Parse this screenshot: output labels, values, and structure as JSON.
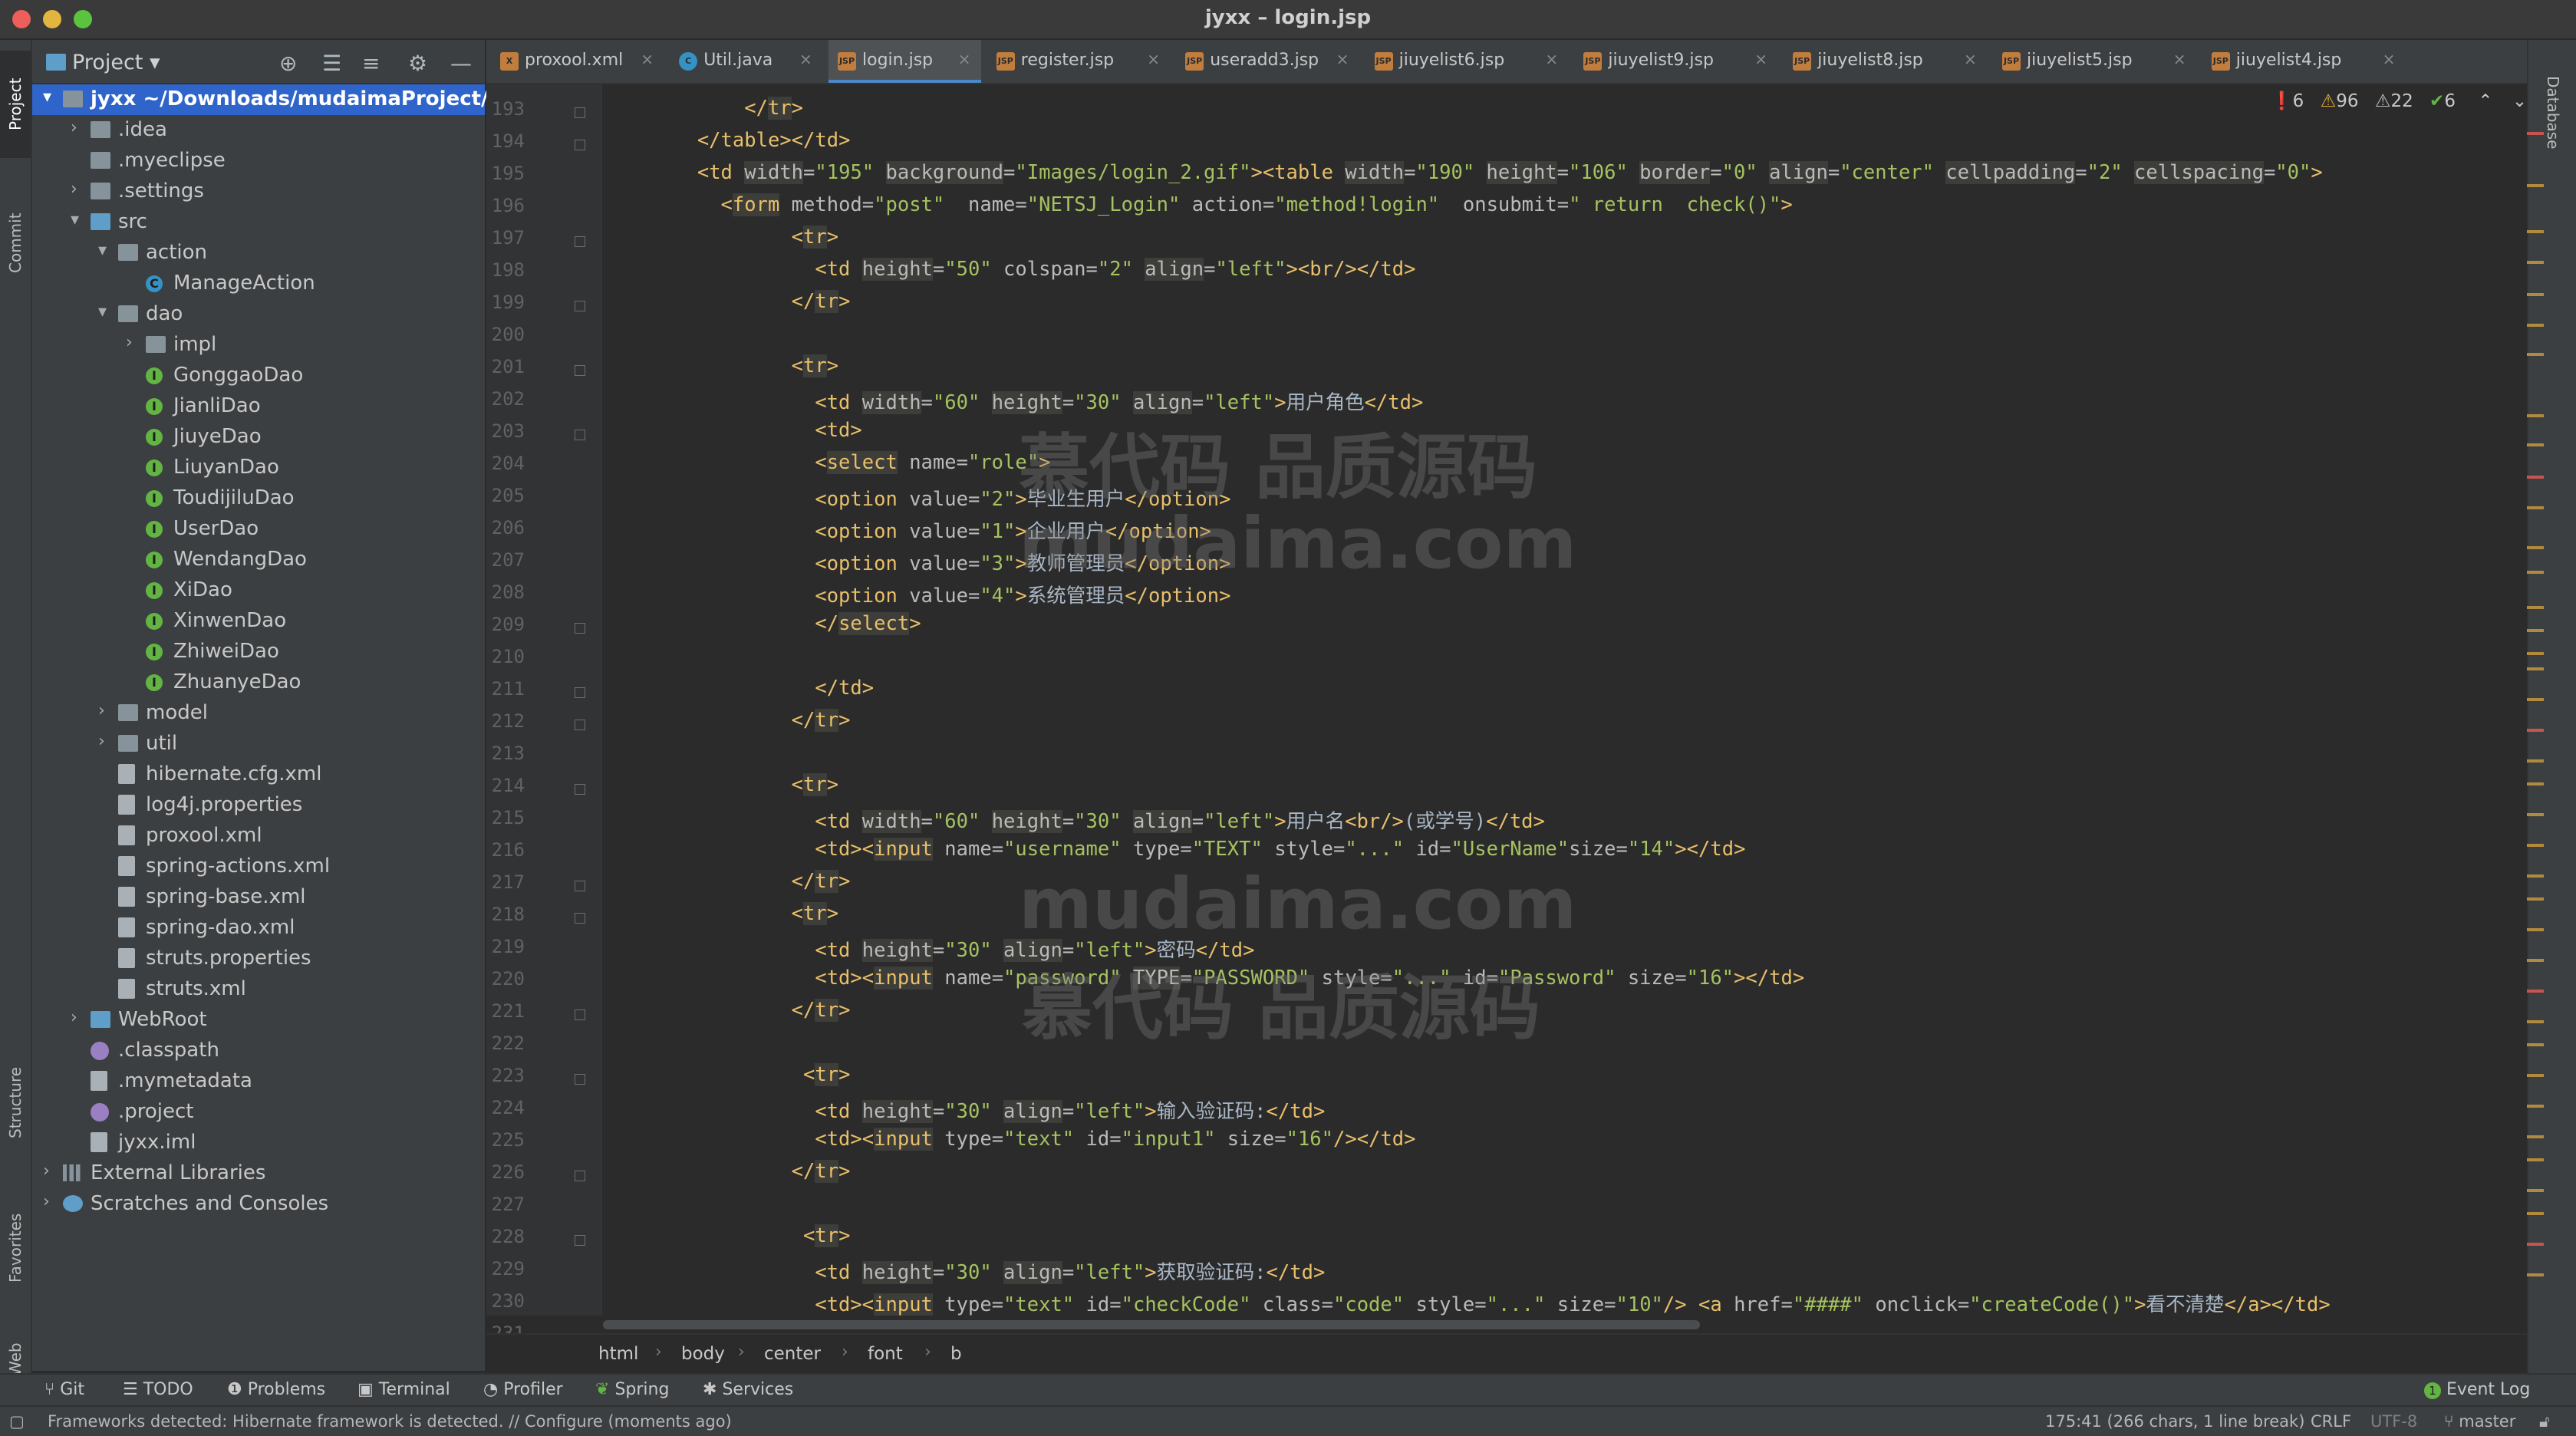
{
  "window": {
    "title": "jyxx – login.jsp"
  },
  "left_stripe": {
    "project": "Project",
    "commit": "Commit",
    "structure": "Structure",
    "favorites": "Favorites",
    "web": "Web"
  },
  "right_stripe": {
    "database": "Database"
  },
  "project_panel": {
    "title": "Project",
    "tree": [
      {
        "label": "jyxx ~/Downloads/mudaimaProject/jyxx",
        "depth": 0,
        "arrow": "▾",
        "icon": "folder",
        "selected": true
      },
      {
        "label": ".idea",
        "depth": 1,
        "arrow": "›",
        "icon": "folder"
      },
      {
        "label": ".myeclipse",
        "depth": 1,
        "arrow": "",
        "icon": "folder"
      },
      {
        "label": ".settings",
        "depth": 1,
        "arrow": "›",
        "icon": "folder"
      },
      {
        "label": "src",
        "depth": 1,
        "arrow": "▾",
        "icon": "src"
      },
      {
        "label": "action",
        "depth": 2,
        "arrow": "▾",
        "icon": "folder"
      },
      {
        "label": "ManageAction",
        "depth": 3,
        "arrow": "",
        "icon": "class"
      },
      {
        "label": "dao",
        "depth": 2,
        "arrow": "▾",
        "icon": "folder"
      },
      {
        "label": "impl",
        "depth": 3,
        "arrow": "›",
        "icon": "folder"
      },
      {
        "label": "GonggaoDao",
        "depth": 3,
        "arrow": "",
        "icon": "interface"
      },
      {
        "label": "JianliDao",
        "depth": 3,
        "arrow": "",
        "icon": "interface"
      },
      {
        "label": "JiuyeDao",
        "depth": 3,
        "arrow": "",
        "icon": "interface"
      },
      {
        "label": "LiuyanDao",
        "depth": 3,
        "arrow": "",
        "icon": "interface"
      },
      {
        "label": "ToudijiluDao",
        "depth": 3,
        "arrow": "",
        "icon": "interface"
      },
      {
        "label": "UserDao",
        "depth": 3,
        "arrow": "",
        "icon": "interface"
      },
      {
        "label": "WendangDao",
        "depth": 3,
        "arrow": "",
        "icon": "interface"
      },
      {
        "label": "XiDao",
        "depth": 3,
        "arrow": "",
        "icon": "interface"
      },
      {
        "label": "XinwenDao",
        "depth": 3,
        "arrow": "",
        "icon": "interface"
      },
      {
        "label": "ZhiweiDao",
        "depth": 3,
        "arrow": "",
        "icon": "interface"
      },
      {
        "label": "ZhuanyeDao",
        "depth": 3,
        "arrow": "",
        "icon": "interface"
      },
      {
        "label": "model",
        "depth": 2,
        "arrow": "›",
        "icon": "folder"
      },
      {
        "label": "util",
        "depth": 2,
        "arrow": "›",
        "icon": "folder"
      },
      {
        "label": "hibernate.cfg.xml",
        "depth": 2,
        "arrow": "",
        "icon": "file"
      },
      {
        "label": "log4j.properties",
        "depth": 2,
        "arrow": "",
        "icon": "file"
      },
      {
        "label": "proxool.xml",
        "depth": 2,
        "arrow": "",
        "icon": "file"
      },
      {
        "label": "spring-actions.xml",
        "depth": 2,
        "arrow": "",
        "icon": "file"
      },
      {
        "label": "spring-base.xml",
        "depth": 2,
        "arrow": "",
        "icon": "file"
      },
      {
        "label": "spring-dao.xml",
        "depth": 2,
        "arrow": "",
        "icon": "file"
      },
      {
        "label": "struts.properties",
        "depth": 2,
        "arrow": "",
        "icon": "file"
      },
      {
        "label": "struts.xml",
        "depth": 2,
        "arrow": "",
        "icon": "file"
      },
      {
        "label": "WebRoot",
        "depth": 1,
        "arrow": "›",
        "icon": "src"
      },
      {
        "label": ".classpath",
        "depth": 1,
        "arrow": "",
        "icon": "eclipse"
      },
      {
        "label": ".mymetadata",
        "depth": 1,
        "arrow": "",
        "icon": "file"
      },
      {
        "label": ".project",
        "depth": 1,
        "arrow": "",
        "icon": "eclipse"
      },
      {
        "label": "jyxx.iml",
        "depth": 1,
        "arrow": "",
        "icon": "file"
      },
      {
        "label": "External Libraries",
        "depth": 0,
        "arrow": "›",
        "icon": "lib"
      },
      {
        "label": "Scratches and Consoles",
        "depth": 0,
        "arrow": "›",
        "icon": "scratch"
      }
    ]
  },
  "tabs": [
    {
      "label": "proxool.xml",
      "icon": "xml",
      "active": false
    },
    {
      "label": "Util.java",
      "icon": "java",
      "active": false
    },
    {
      "label": "login.jsp",
      "icon": "jsp",
      "active": true
    },
    {
      "label": "register.jsp",
      "icon": "jsp",
      "active": false
    },
    {
      "label": "useradd3.jsp",
      "icon": "jsp",
      "active": false
    },
    {
      "label": "jiuyelist6.jsp",
      "icon": "jsp",
      "active": false
    },
    {
      "label": "jiuyelist9.jsp",
      "icon": "jsp",
      "active": false
    },
    {
      "label": "jiuyelist8.jsp",
      "icon": "jsp",
      "active": false
    },
    {
      "label": "jiuyelist5.jsp",
      "icon": "jsp",
      "active": false
    },
    {
      "label": "jiuyelist4.jsp",
      "icon": "jsp",
      "active": false
    }
  ],
  "inspections": {
    "errors": "6",
    "warnings": "96",
    "weak_warnings": "22",
    "ok": "6"
  },
  "editor": {
    "lines": [
      {
        "n": "193",
        "code": "            </tr>"
      },
      {
        "n": "194",
        "code": "        </table></td>"
      },
      {
        "n": "195",
        "code": "        <td width=\"195\" background=\"Images/login_2.gif\"><table width=\"190\" height=\"106\" border=\"0\" align=\"center\" cellpadding=\"2\" cellspacing=\"0\">"
      },
      {
        "n": "196",
        "code": "          <form method=\"post\"  name=\"NETSJ_Login\" action=\"method!login\"  onsubmit=\" return  check()\">"
      },
      {
        "n": "197",
        "code": "                <tr>"
      },
      {
        "n": "198",
        "code": "                  <td height=\"50\" colspan=\"2\" align=\"left\"><br/></td>"
      },
      {
        "n": "199",
        "code": "                </tr>"
      },
      {
        "n": "200",
        "code": ""
      },
      {
        "n": "201",
        "code": "                <tr>"
      },
      {
        "n": "202",
        "code": "                  <td width=\"60\" height=\"30\" align=\"left\">用户角色</td>"
      },
      {
        "n": "203",
        "code": "                  <td>"
      },
      {
        "n": "204",
        "code": "                  <select name=\"role\">"
      },
      {
        "n": "205",
        "code": "                  <option value=\"2\">毕业生用户</option>"
      },
      {
        "n": "206",
        "code": "                  <option value=\"1\">企业用户</option>"
      },
      {
        "n": "207",
        "code": "                  <option value=\"3\">教师管理员</option>"
      },
      {
        "n": "208",
        "code": "                  <option value=\"4\">系统管理员</option>"
      },
      {
        "n": "209",
        "code": "                  </select>"
      },
      {
        "n": "210",
        "code": ""
      },
      {
        "n": "211",
        "code": "                  </td>"
      },
      {
        "n": "212",
        "code": "                </tr>"
      },
      {
        "n": "213",
        "code": ""
      },
      {
        "n": "214",
        "code": "                <tr>"
      },
      {
        "n": "215",
        "code": "                  <td width=\"60\" height=\"30\" align=\"left\">用户名<br/>(或学号)</td>"
      },
      {
        "n": "216",
        "code": "                  <td><input name=\"username\" type=\"TEXT\" style=\"...\" id=\"UserName\"size=\"14\"></td>"
      },
      {
        "n": "217",
        "code": "                </tr>"
      },
      {
        "n": "218",
        "code": "                <tr>"
      },
      {
        "n": "219",
        "code": "                  <td height=\"30\" align=\"left\">密码</td>"
      },
      {
        "n": "220",
        "code": "                  <td><input name=\"password\" TYPE=\"PASSWORD\" style=\"...\" id=\"Password\" size=\"16\"></td>"
      },
      {
        "n": "221",
        "code": "                </tr>"
      },
      {
        "n": "222",
        "code": ""
      },
      {
        "n": "223",
        "code": "                 <tr>"
      },
      {
        "n": "224",
        "code": "                  <td height=\"30\" align=\"left\">输入验证码:</td>"
      },
      {
        "n": "225",
        "code": "                  <td><input type=\"text\" id=\"input1\" size=\"16\"/></td>"
      },
      {
        "n": "226",
        "code": "                </tr>"
      },
      {
        "n": "227",
        "code": ""
      },
      {
        "n": "228",
        "code": "                 <tr>"
      },
      {
        "n": "229",
        "code": "                  <td height=\"30\" align=\"left\">获取验证码:</td>"
      },
      {
        "n": "230",
        "code": "                  <td><input type=\"text\" id=\"checkCode\" class=\"code\" style=\"...\" size=\"10\"/> <a href=\"####\" onclick=\"createCode()\">看不清楚</a></td>"
      },
      {
        "n": "231",
        "code": ""
      }
    ]
  },
  "watermarks": [
    "慕代码 品质源码",
    "mudaima.com",
    "mudaima.com",
    "慕代码 品质源码"
  ],
  "breadcrumb": [
    "html",
    "body",
    "center",
    "font",
    "b"
  ],
  "tool_windows": {
    "git": "Git",
    "todo": "TODO",
    "problems": "Problems",
    "terminal": "Terminal",
    "profiler": "Profiler",
    "spring": "Spring",
    "services": "Services",
    "event_log": "Event Log",
    "event_log_count": "1"
  },
  "status": {
    "message": "Frameworks detected: Hibernate framework is detected. // Configure (moments ago)",
    "position": "175:41 (266 chars, 1 line break)",
    "line_sep": "CRLF",
    "encoding": "UTF-8",
    "branch": "master"
  },
  "colors": {
    "tag": "#e8bf6a",
    "attr": "#bababa",
    "value": "#a5c261",
    "selection": "#2f65ca",
    "error": "#c75450",
    "warning": "#e0a838",
    "ok": "#62b543"
  }
}
